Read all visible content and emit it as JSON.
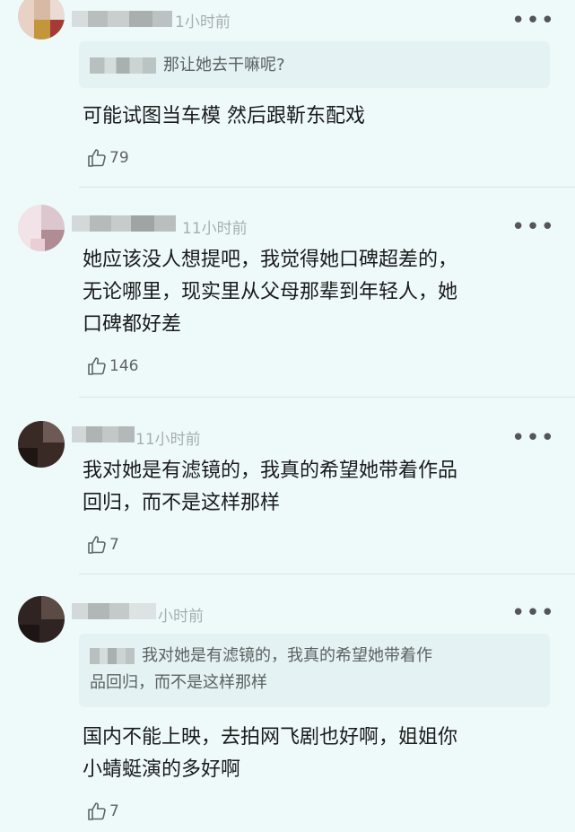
{
  "comments": [
    {
      "time": "1小时前",
      "more": "•••",
      "reply_to": {
        "suffix": "",
        "text": "那让她去干嘛呢?"
      },
      "text_lines": [
        "可能试图当车模 然后跟靳东配戏"
      ],
      "likes": "79"
    },
    {
      "time": "11小时前",
      "more": "•••",
      "text_lines": [
        "她应该没人想提吧，我觉得她口碑超差的，",
        "无论哪里，现实里从父母那辈到年轻人，她",
        "口碑都好差"
      ],
      "likes": "146"
    },
    {
      "time": "11小时前",
      "more": "•••",
      "text_lines": [
        "我对她是有滤镜的，我真的希望她带着作品",
        "回归，而不是这样那样"
      ],
      "likes": "7"
    },
    {
      "time": "小时前",
      "more": "•••",
      "reply_to": {
        "suffix": "",
        "lines": [
          "我对她是有滤镜的，我真的希望她带着作",
          "品回归，而不是这样那样"
        ]
      },
      "text_lines": [
        "国内不能上映，去拍网飞剧也好啊，姐姐你",
        "小蜻蜓演的多好啊"
      ],
      "likes": "7"
    }
  ],
  "icons": {
    "like": "thumbs-up-icon",
    "more": "more-dots-icon"
  },
  "colors": {
    "background": "#eefafa",
    "quote_bg": "#e4f2f3",
    "time": "#a6aeae"
  }
}
